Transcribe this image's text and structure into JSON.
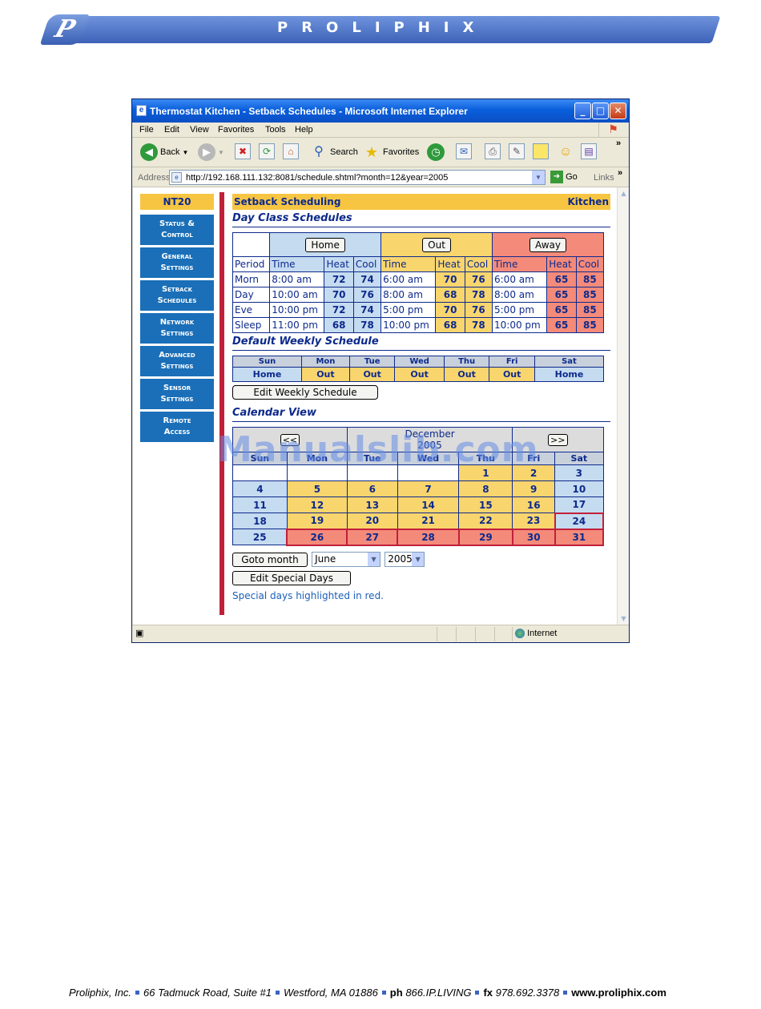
{
  "banner": {
    "logo_letter": "P",
    "brand": "PROLIPHIX"
  },
  "window": {
    "title": "Thermostat Kitchen - Setback Schedules - Microsoft Internet Explorer",
    "menu": [
      "File",
      "Edit",
      "View",
      "Favorites",
      "Tools",
      "Help"
    ],
    "toolbar": {
      "back": "Back",
      "search": "Search",
      "favorites": "Favorites"
    },
    "address": {
      "label": "Address",
      "url": "http://192.168.111.132:8081/schedule.shtml?month=12&year=2005",
      "go": "Go",
      "links": "Links"
    },
    "status": {
      "zone": "Internet"
    }
  },
  "nav": {
    "model": "NT20",
    "items": [
      {
        "line1": "Status &",
        "line2": "Control"
      },
      {
        "line1": "General",
        "line2": "Settings"
      },
      {
        "line1": "Setback",
        "line2": "Schedules"
      },
      {
        "line1": "Network",
        "line2": "Settings"
      },
      {
        "line1": "Advanced",
        "line2": "Settings"
      },
      {
        "line1": "Sensor",
        "line2": "Settings"
      },
      {
        "line1": "Remote",
        "line2": "Access"
      }
    ]
  },
  "main": {
    "header_left": "Setback Scheduling",
    "header_right": "Kitchen",
    "day_class_title": "Day Class Schedules",
    "classes": {
      "home": "Home",
      "out": "Out",
      "away": "Away"
    },
    "columns": {
      "period": "Period",
      "time": "Time",
      "heat": "Heat",
      "cool": "Cool"
    },
    "periods": [
      {
        "name": "Morn",
        "home": [
          "8:00 am",
          "72",
          "74"
        ],
        "out": [
          "6:00 am",
          "70",
          "76"
        ],
        "away": [
          "6:00 am",
          "65",
          "85"
        ]
      },
      {
        "name": "Day",
        "home": [
          "10:00 am",
          "70",
          "76"
        ],
        "out": [
          "8:00 am",
          "68",
          "78"
        ],
        "away": [
          "8:00 am",
          "65",
          "85"
        ]
      },
      {
        "name": "Eve",
        "home": [
          "10:00 pm",
          "72",
          "74"
        ],
        "out": [
          "5:00 pm",
          "70",
          "76"
        ],
        "away": [
          "5:00 pm",
          "65",
          "85"
        ]
      },
      {
        "name": "Sleep",
        "home": [
          "11:00 pm",
          "68",
          "78"
        ],
        "out": [
          "10:00 pm",
          "68",
          "78"
        ],
        "away": [
          "10:00 pm",
          "65",
          "85"
        ]
      }
    ],
    "weekly_title": "Default Weekly Schedule",
    "weekly": {
      "days": [
        "Sun",
        "Mon",
        "Tue",
        "Wed",
        "Thu",
        "Fri",
        "Sat"
      ],
      "values": [
        "Home",
        "Out",
        "Out",
        "Out",
        "Out",
        "Out",
        "Home"
      ]
    },
    "edit_weekly": "Edit Weekly Schedule",
    "calendar_title": "Calendar View",
    "calendar": {
      "prev": "<<",
      "next": ">>",
      "month": "December",
      "year": "2005",
      "days": [
        "Sun",
        "Mon",
        "Tue",
        "Wed",
        "Thu",
        "Fri",
        "Sat"
      ],
      "weeks": [
        [
          "",
          "",
          "",
          "",
          "1",
          "2",
          "3"
        ],
        [
          "4",
          "5",
          "6",
          "7",
          "8",
          "9",
          "10"
        ],
        [
          "11",
          "12",
          "13",
          "14",
          "15",
          "16",
          "17"
        ],
        [
          "18",
          "19",
          "20",
          "21",
          "22",
          "23",
          "24"
        ],
        [
          "25",
          "26",
          "27",
          "28",
          "29",
          "30",
          "31"
        ]
      ]
    },
    "goto_month": "Goto month",
    "month_select": "June",
    "year_select": "2005",
    "edit_special": "Edit Special Days",
    "note": "Special days highlighted in red."
  },
  "watermark": "Manualslib.com",
  "footer": {
    "company": "Proliphix, Inc.",
    "address": "66 Tadmuck Road, Suite #1",
    "city": "Westford, MA 01886",
    "ph_label": "ph",
    "ph": "866.IP.LIVING",
    "fx_label": "fx",
    "fx": "978.692.3378",
    "web": "www.proliphix.com"
  },
  "colors": {
    "home": "#c5dbf0",
    "out": "#f9d56e",
    "away": "#f48a7a",
    "nav": "#1a6fb8",
    "accent_red": "#c0203a",
    "header": "#f7c542"
  }
}
